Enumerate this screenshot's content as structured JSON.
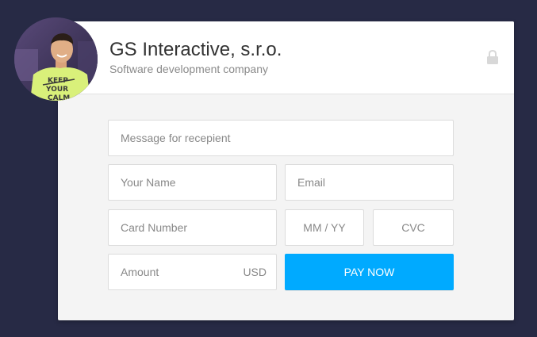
{
  "header": {
    "company_name": "GS Interactive, s.r.o.",
    "subtitle": "Software development company",
    "lock_icon": "lock-icon",
    "avatar_shirt_text": [
      "KEEP",
      "YOUR",
      "CALM"
    ]
  },
  "form": {
    "message_placeholder": "Message for recepient",
    "name_placeholder": "Your Name",
    "email_placeholder": "Email",
    "card_number_placeholder": "Card Number",
    "expiry_placeholder": "MM / YY",
    "cvc_placeholder": "CVC",
    "amount_placeholder": "Amount",
    "currency": "USD",
    "pay_button_label": "PAY NOW"
  },
  "colors": {
    "background": "#272a45",
    "accent": "#00aaff",
    "card": "#f4f4f4",
    "header": "#ffffff"
  }
}
